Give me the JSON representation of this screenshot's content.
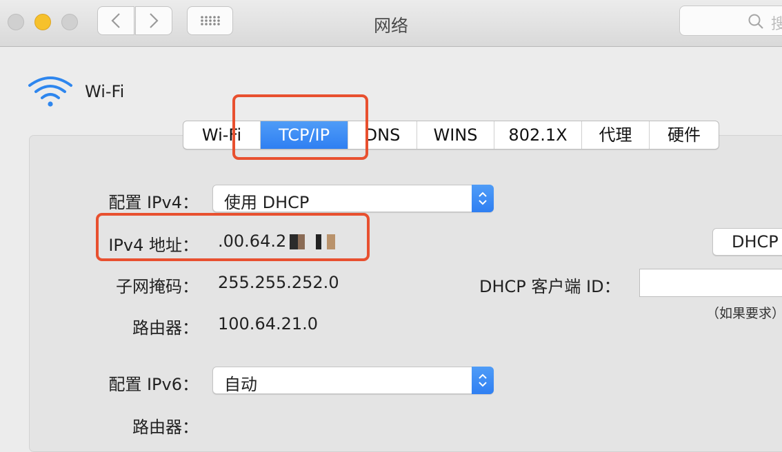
{
  "window": {
    "title": "网络",
    "search_placeholder": "搜"
  },
  "service": {
    "name": "Wi-Fi",
    "icon": "wifi-icon"
  },
  "tabs": [
    {
      "label": "Wi-Fi",
      "active": false
    },
    {
      "label": "TCP/IP",
      "active": true
    },
    {
      "label": "DNS",
      "active": false
    },
    {
      "label": "WINS",
      "active": false
    },
    {
      "label": "802.1X",
      "active": false
    },
    {
      "label": "代理",
      "active": false
    },
    {
      "label": "硬件",
      "active": false
    }
  ],
  "form": {
    "configure_ipv4_label": "配置 IPv4：",
    "configure_ipv4_value": "使用 DHCP",
    "ipv4_address_label": "IPv4 地址：",
    "ipv4_address_value": ".00.64.2",
    "subnet_mask_label": "子网掩码：",
    "subnet_mask_value": "255.255.252.0",
    "router_label": "路由器：",
    "router_value": "100.64.21.0",
    "configure_ipv6_label": "配置 IPv6：",
    "configure_ipv6_value": "自动",
    "router6_label": "路由器：",
    "renew_dhcp_label": "DHCP",
    "dhcp_client_id_label": "DHCP 客户端 ID：",
    "dhcp_client_id_value": "",
    "dhcp_client_id_hint": "（如果要求）"
  },
  "colors": {
    "accent": "#2f7ff2",
    "highlight": "#e8502f",
    "background": "#ececec"
  }
}
